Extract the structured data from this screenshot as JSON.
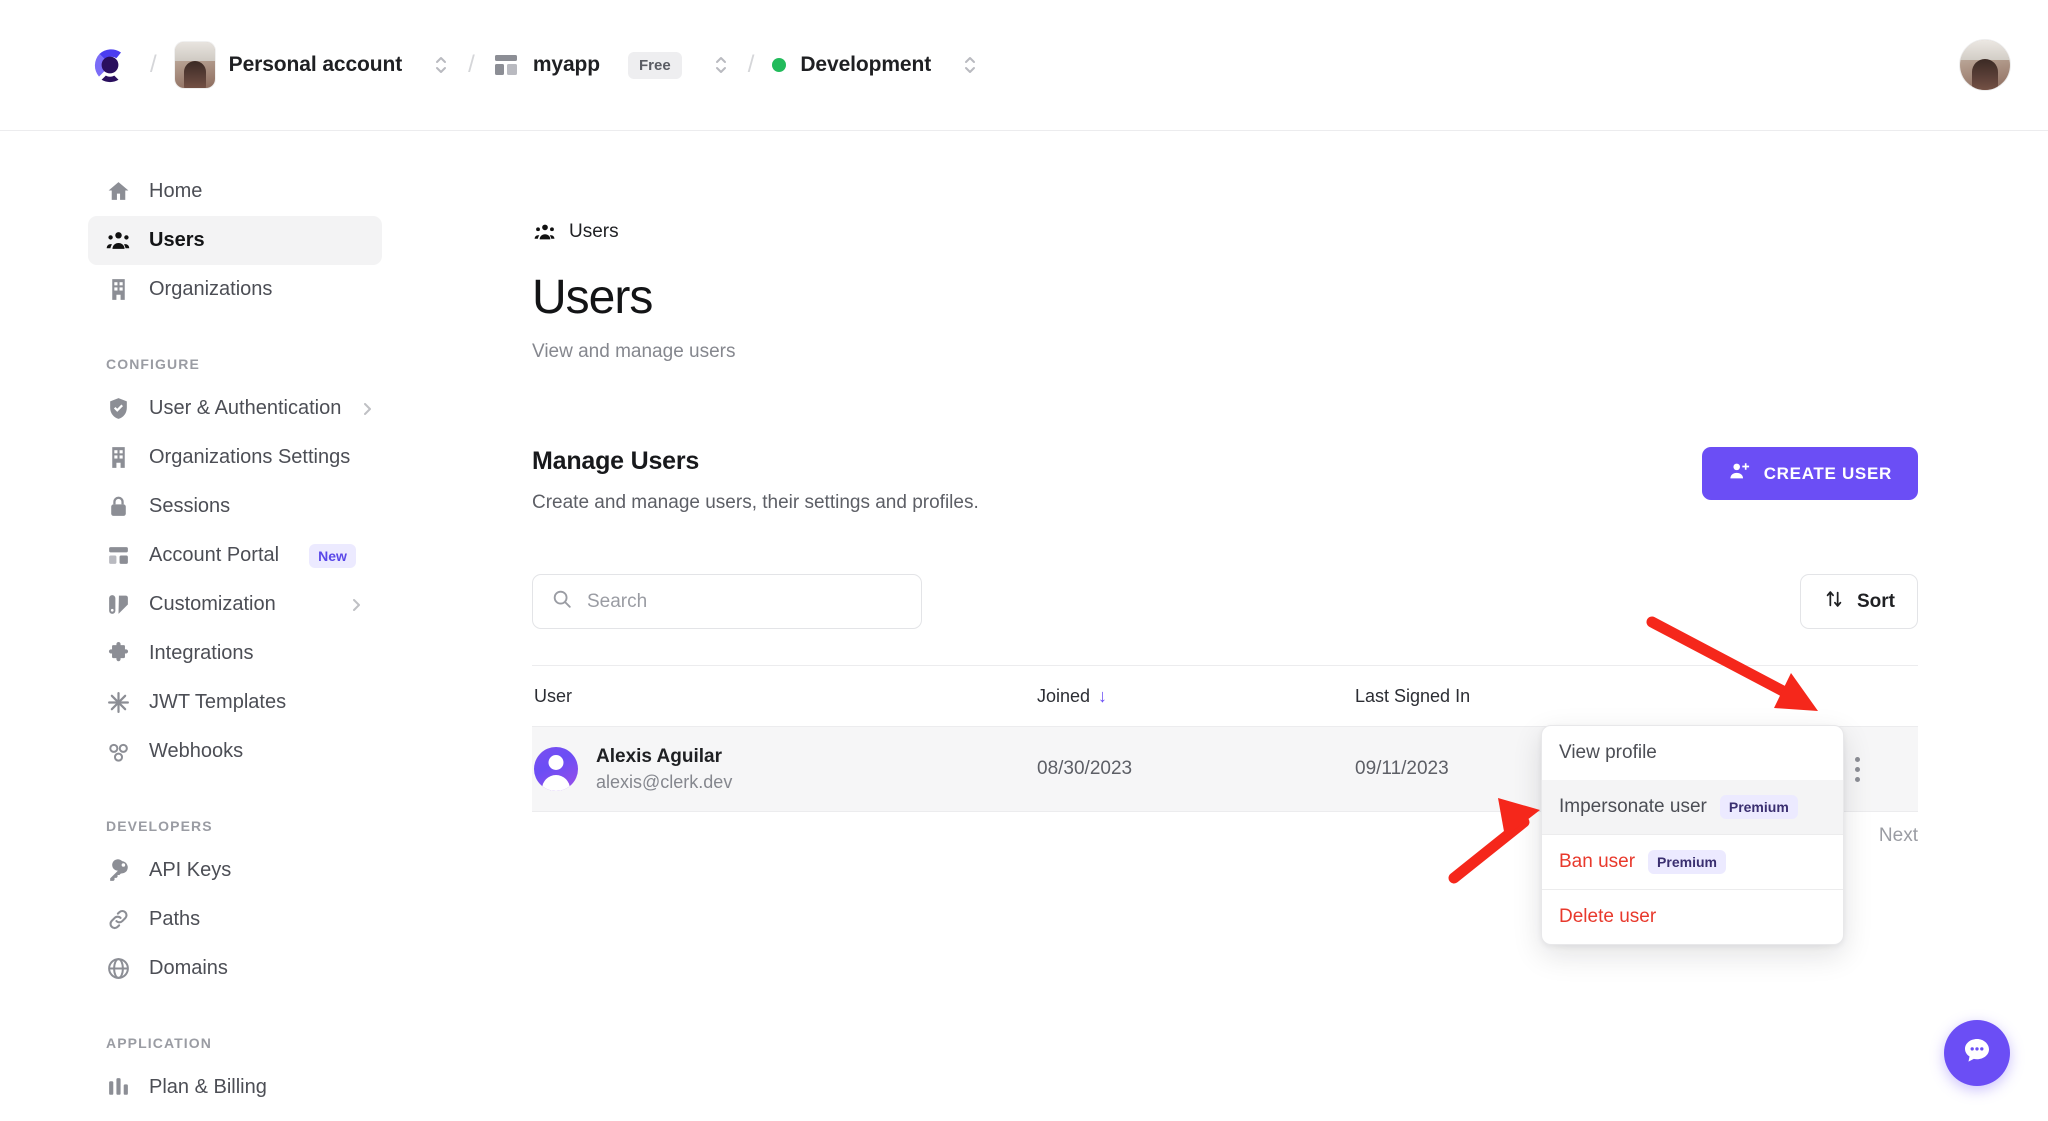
{
  "topbar": {
    "logo_icon": "clerk-logo-icon",
    "separator": "/",
    "account": {
      "label": "Personal account",
      "avatar_icon": "account-avatar",
      "switcher_icon": "chevron-up-down-icon"
    },
    "app": {
      "label": "myapp",
      "plan_badge": "Free",
      "app_icon": "app-grid-icon",
      "switcher_icon": "chevron-up-down-icon"
    },
    "environment": {
      "label": "Development",
      "status_color": "#22bb5b",
      "switcher_icon": "chevron-up-down-icon"
    },
    "user_avatar_icon": "user-avatar"
  },
  "sidebar": {
    "primary": [
      {
        "label": "Home",
        "icon": "home-icon",
        "active": false
      },
      {
        "label": "Users",
        "icon": "users-icon",
        "active": true
      },
      {
        "label": "Organizations",
        "icon": "building-icon",
        "active": false
      }
    ],
    "sections": [
      {
        "title": "CONFIGURE",
        "items": [
          {
            "label": "User & Authentication",
            "icon": "shield-check-icon",
            "caret": true
          },
          {
            "label": "Organizations Settings",
            "icon": "building-icon",
            "caret": false
          },
          {
            "label": "Sessions",
            "icon": "lock-icon",
            "caret": false
          },
          {
            "label": "Account Portal",
            "icon": "layout-icon",
            "caret": false,
            "badge": "New"
          },
          {
            "label": "Customization",
            "icon": "palette-icon",
            "caret": true
          },
          {
            "label": "Integrations",
            "icon": "puzzle-icon",
            "caret": false
          },
          {
            "label": "JWT Templates",
            "icon": "asterisk-icon",
            "caret": false
          },
          {
            "label": "Webhooks",
            "icon": "webhook-icon",
            "caret": false
          }
        ]
      },
      {
        "title": "DEVELOPERS",
        "items": [
          {
            "label": "API Keys",
            "icon": "key-icon",
            "caret": false
          },
          {
            "label": "Paths",
            "icon": "link-icon",
            "caret": false
          },
          {
            "label": "Domains",
            "icon": "globe-icon",
            "caret": false
          }
        ]
      },
      {
        "title": "APPLICATION",
        "items": [
          {
            "label": "Plan & Billing",
            "icon": "billing-icon",
            "caret": false
          }
        ]
      }
    ]
  },
  "main": {
    "breadcrumb": {
      "label": "Users",
      "icon": "users-icon"
    },
    "title": "Users",
    "subtitle": "View and manage users",
    "section": {
      "title": "Manage Users",
      "subtitle": "Create and manage users, their settings and profiles.",
      "create_button": {
        "label": "CREATE USER",
        "icon": "user-plus-icon",
        "color": "#6b4ef5"
      }
    },
    "toolbar": {
      "search": {
        "placeholder": "Search",
        "value": "",
        "icon": "search-icon"
      },
      "sort_button": {
        "label": "Sort",
        "icon": "sort-arrows-icon"
      }
    },
    "table": {
      "columns": [
        {
          "label": "User"
        },
        {
          "label": "Joined",
          "sorted": true,
          "sort_icon": "arrow-down-icon"
        },
        {
          "label": "Last Signed In"
        },
        {
          "label": ""
        }
      ],
      "rows": [
        {
          "name": "Alexis Aguilar",
          "email": "alexis@clerk.dev",
          "joined": "08/30/2023",
          "last_signed_in": "09/11/2023",
          "avatar_icon": "user-avatar",
          "actions_icon": "kebab-menu-icon"
        }
      ],
      "pager_next": "Next"
    },
    "context_menu": {
      "items": [
        {
          "label": "View profile",
          "danger": false,
          "badge": null,
          "hover": false
        },
        {
          "label": "Impersonate user",
          "danger": false,
          "badge": "Premium",
          "hover": true
        },
        {
          "label": "Ban user",
          "danger": true,
          "badge": "Premium",
          "hover": false
        },
        {
          "label": "Delete user",
          "danger": true,
          "badge": null,
          "hover": false
        }
      ]
    }
  },
  "chat_fab": {
    "icon": "chat-bubble-icon",
    "color": "#6b4ef5"
  }
}
